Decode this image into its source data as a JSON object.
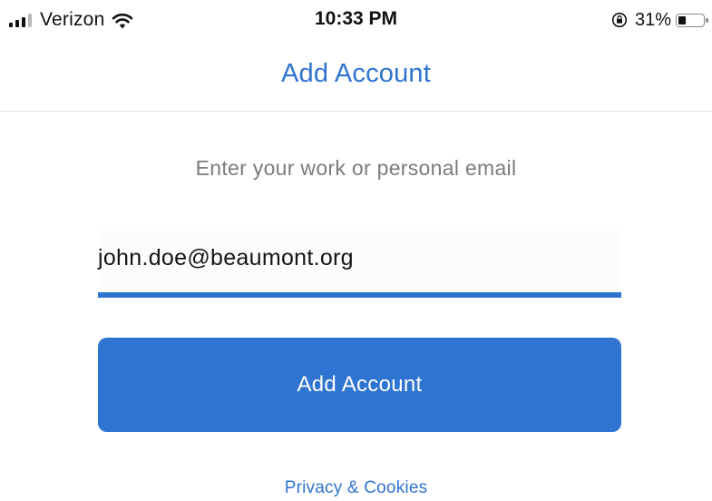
{
  "status_bar": {
    "carrier": "Verizon",
    "time": "10:33 PM",
    "battery_percent": "31%",
    "battery_level": 0.31,
    "icons": [
      "signal-icon",
      "wifi-icon",
      "rotation-lock-icon",
      "battery-icon"
    ]
  },
  "header": {
    "title": "Add Account"
  },
  "form": {
    "prompt": "Enter your work or personal email",
    "email_value": "john.doe@beaumont.org",
    "submit_label": "Add Account"
  },
  "footer": {
    "privacy_link": "Privacy & Cookies"
  },
  "colors": {
    "accent": "#2f74d0",
    "prompt_text": "#7b7b7b",
    "background": "#ffffff"
  }
}
